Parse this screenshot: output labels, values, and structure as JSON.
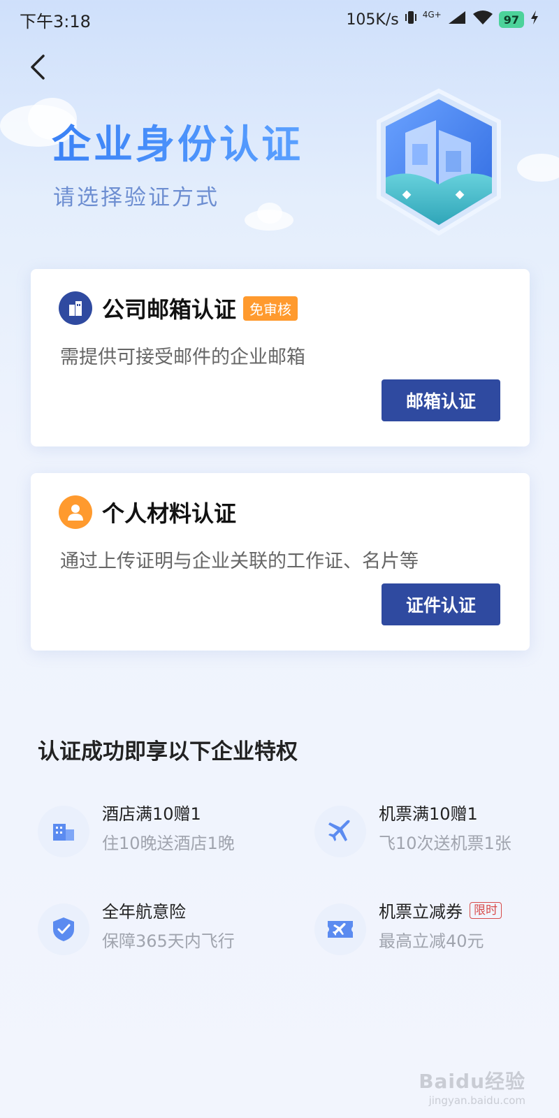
{
  "status_bar": {
    "time": "下午3:18",
    "network_speed": "105K/s",
    "signal": "4G+",
    "battery": "97"
  },
  "header": {
    "back_icon": "chevron-left-icon",
    "title": "企业身份认证",
    "subtitle": "请选择验证方式"
  },
  "cards": [
    {
      "icon": "building-icon",
      "title": "公司邮箱认证",
      "tag": "免审核",
      "description": "需提供可接受邮件的企业邮箱",
      "button": "邮箱认证"
    },
    {
      "icon": "person-icon",
      "title": "个人材料认证",
      "description": "通过上传证明与企业关联的工作证、名片等",
      "button": "证件认证"
    }
  ],
  "privileges": {
    "heading": "认证成功即享以下企业特权",
    "items": [
      {
        "icon": "hotel-building-icon",
        "title": "酒店满10赠1",
        "desc": "住10晚送酒店1晚"
      },
      {
        "icon": "airplane-icon",
        "title": "机票满10赠1",
        "desc": "飞10次送机票1张"
      },
      {
        "icon": "shield-check-icon",
        "title": "全年航意险",
        "desc": "保障365天内飞行"
      },
      {
        "icon": "flight-ticket-icon",
        "title": "机票立减券",
        "tag": "限时",
        "desc": "最高立减40元"
      }
    ]
  },
  "watermark": {
    "main": "Baidu经验",
    "sub": "jingyan.baidu.com"
  },
  "colors": {
    "primary": "#2f4aa0",
    "accent_orange": "#ff9a2e",
    "title_blue": "#3b82f6",
    "tag_red": "#d84a4a"
  }
}
